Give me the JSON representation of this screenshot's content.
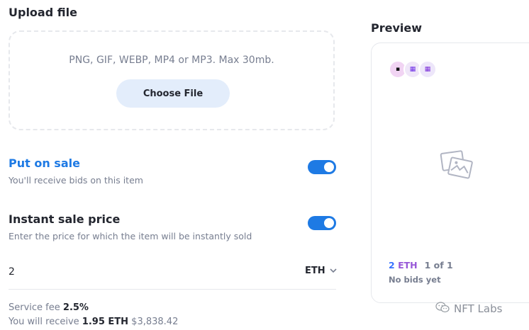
{
  "upload": {
    "title": "Upload file",
    "hint": "PNG, GIF, WEBP, MP4 or MP3. Max 30mb.",
    "button_label": "Choose File"
  },
  "put_on_sale": {
    "title": "Put on sale",
    "subtitle": "You'll receive bids on this item",
    "enabled": true,
    "title_color": "#1e7ae4"
  },
  "instant_sale": {
    "title": "Instant sale price",
    "subtitle": "Enter the price for which the item will be instantly sold",
    "enabled": true
  },
  "price": {
    "value": "2",
    "currency": "ETH"
  },
  "fees": {
    "service_label": "Service fee",
    "service_value": "2.5%",
    "receive_label": "You will receive",
    "receive_eth": "1.95 ETH",
    "receive_usd": "$3,838.42"
  },
  "preview": {
    "title": "Preview",
    "price_num": "2",
    "price_unit": "ETH",
    "count": "1 of 1",
    "bids": "No bids yet"
  },
  "watermark": {
    "text": "NFT Labs"
  },
  "colors": {
    "accent": "#1e7ae4",
    "button_bg": "#e3edfb",
    "muted": "#777e90"
  },
  "icons": [
    "image-placeholder-icon",
    "chevron-down-icon",
    "wechat-icon"
  ]
}
